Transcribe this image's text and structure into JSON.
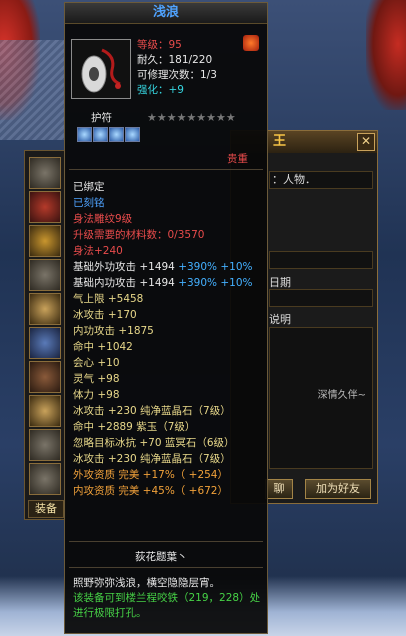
{
  "item": {
    "name": "浅浪",
    "level": "等级：95",
    "durability": "耐久：181/220",
    "repair": "可修理次数：1/3",
    "enhance_label": "强化：",
    "enhance_value": "+9",
    "charm_label": "护符",
    "rarity": "贵重"
  },
  "stats": [
    {
      "text": "已绑定",
      "color": "white"
    },
    {
      "text": "已刻铭",
      "color": "blue"
    },
    {
      "text": "身法雕纹9级",
      "color": "red"
    },
    {
      "text": "升级需要的材料数：0/3570",
      "color": "red"
    },
    {
      "text": "身法+240",
      "color": "red"
    },
    {
      "text": "基础外功攻击 +1494",
      "color": "white",
      "extra": "+390%",
      "extra2": "+10%"
    },
    {
      "text": "基础内功攻击 +1494",
      "color": "white",
      "extra": "+390%",
      "extra2": "+10%"
    },
    {
      "text": "气上限 +5458",
      "color": "yellow"
    },
    {
      "text": "冰攻击 +170",
      "color": "yellow"
    },
    {
      "text": "内功攻击 +1875",
      "color": "yellow"
    },
    {
      "text": "命中 +1042",
      "color": "yellow"
    },
    {
      "text": "会心 +10",
      "color": "yellow"
    },
    {
      "text": "灵气 +98",
      "color": "yellow"
    },
    {
      "text": "体力 +98",
      "color": "yellow"
    },
    {
      "text": "冰攻击 +230 纯净蓝晶石（7级）",
      "color": "yellow"
    },
    {
      "text": "命中 +2889 紫玉（7级）",
      "color": "yellow"
    },
    {
      "text": "忽略目标冰抗 +70 蓝冥石（6级）",
      "color": "yellow"
    },
    {
      "text": "冰攻击 +230 纯净蓝晶石（7级）",
      "color": "yellow"
    },
    {
      "text": "外攻资质  完美 +17%（ +254）",
      "color": "orange"
    },
    {
      "text": "内攻资质  完美 +45%（ +672）",
      "color": "orange"
    }
  ],
  "footer": {
    "maker": "荻花题葉丶",
    "desc": "照野弥弥浅浪，横空隐隐层宵。",
    "hint": "该装备可到楼兰程咬铁（219，228）处进行极限打孔。"
  },
  "bg_panel": {
    "title": "王",
    "field1": "：人物．",
    "label_date": "日期",
    "label_desc": "说明",
    "signature": "深情久伴~",
    "chat_btn": "聊",
    "add_friend_btn": "加为好友",
    "equip_tab": "装备"
  }
}
